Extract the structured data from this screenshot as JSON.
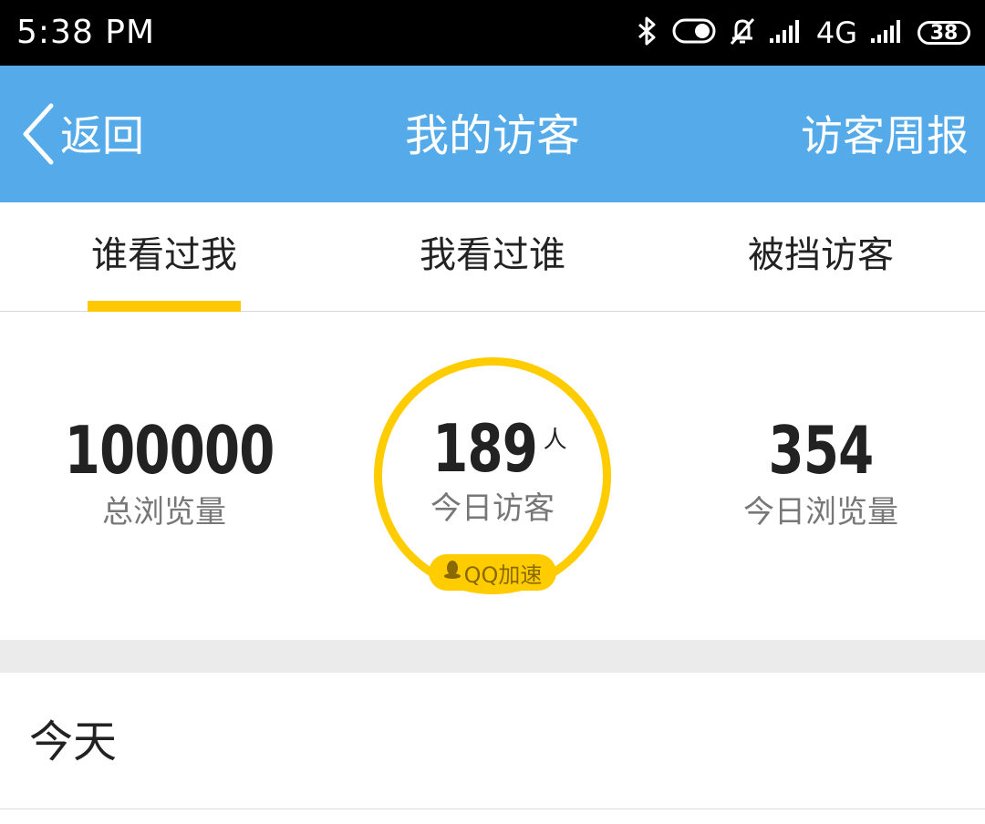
{
  "status_bar": {
    "time": "5:38 PM",
    "network": "4G",
    "battery": "38",
    "icons": [
      "bluetooth-icon",
      "toggle-icon",
      "bell-off-icon",
      "signal-icon",
      "signal-icon"
    ]
  },
  "header": {
    "back_label": "返回",
    "title": "我的访客",
    "right_action": "访客周报"
  },
  "tabs": [
    {
      "label": "谁看过我",
      "active": true
    },
    {
      "label": "我看过谁",
      "active": false
    },
    {
      "label": "被挡访客",
      "active": false
    }
  ],
  "stats": {
    "total_views": {
      "value": "100000",
      "label": "总浏览量"
    },
    "today_visitors": {
      "value": "189",
      "unit": "人",
      "label": "今日访客"
    },
    "today_views": {
      "value": "354",
      "label": "今日浏览量"
    },
    "badge": "QQ加速"
  },
  "section": {
    "title": "今天"
  },
  "colors": {
    "header_bg": "#55aae9",
    "accent": "#ffcc00",
    "status_bar_bg": "#000000"
  }
}
